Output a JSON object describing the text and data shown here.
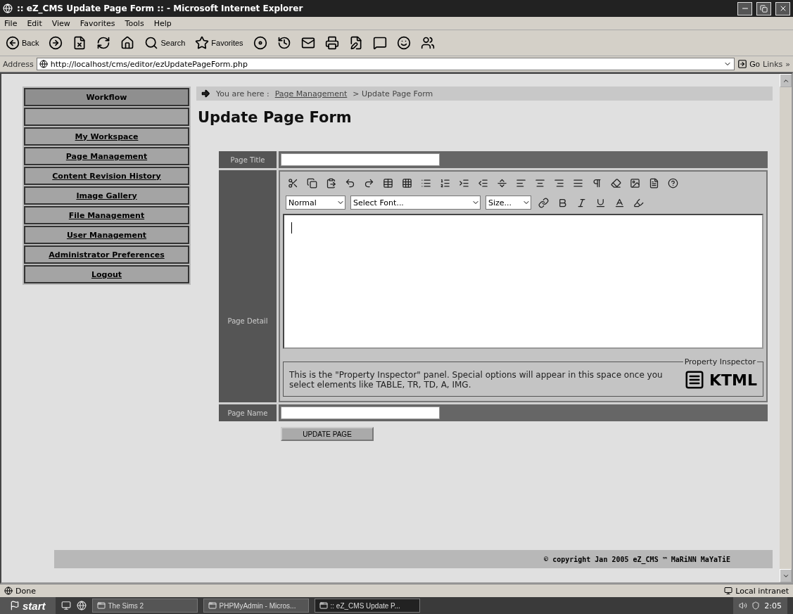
{
  "window": {
    "title": ":: eZ_CMS Update Page Form :: - Microsoft Internet Explorer"
  },
  "menu": [
    "File",
    "Edit",
    "View",
    "Favorites",
    "Tools",
    "Help"
  ],
  "toolbar": [
    {
      "kind": "back",
      "label": "Back"
    },
    {
      "kind": "forward"
    },
    {
      "kind": "stop"
    },
    {
      "kind": "refresh"
    },
    {
      "kind": "home"
    },
    {
      "kind": "search",
      "label": "Search"
    },
    {
      "kind": "favorites",
      "label": "Favorites"
    },
    {
      "kind": "media"
    },
    {
      "kind": "history"
    },
    {
      "kind": "mail"
    },
    {
      "kind": "print"
    },
    {
      "kind": "edit"
    },
    {
      "kind": "discuss"
    },
    {
      "kind": "messenger"
    },
    {
      "kind": "users"
    }
  ],
  "address": {
    "label": "Address",
    "value": "http://localhost/cms/editor/ezUpdatePageForm.php",
    "go": "Go",
    "links": "Links",
    "more": "»"
  },
  "sidebar": {
    "items": [
      {
        "label": "Workflow",
        "kind": "header"
      },
      {
        "kind": "blank"
      },
      {
        "label": "My Workspace",
        "kind": "link"
      },
      {
        "label": "Page Management",
        "kind": "link"
      },
      {
        "label": "Content Revision History",
        "kind": "link"
      },
      {
        "label": "Image Gallery",
        "kind": "link"
      },
      {
        "label": "File Management",
        "kind": "link"
      },
      {
        "label": "User Management",
        "kind": "link"
      },
      {
        "label": "Administrator Preferences",
        "kind": "link"
      },
      {
        "label": "Logout",
        "kind": "link"
      }
    ]
  },
  "breadcrumb": {
    "prefix": "You are here :",
    "link": "Page Management",
    "current": "> Update Page Form"
  },
  "heading": "Update Page Form",
  "form": {
    "title_label": "Page Title",
    "detail_label": "Page Detail",
    "name_label": "Page Name",
    "editor": {
      "toolbar1": [
        {
          "kind": "cut"
        },
        {
          "kind": "copy"
        },
        {
          "kind": "paste"
        },
        {
          "kind": "undo"
        },
        {
          "kind": "redo"
        },
        {
          "kind": "table"
        },
        {
          "kind": "grid"
        },
        {
          "kind": "bullets"
        },
        {
          "kind": "numbers"
        },
        {
          "kind": "indent"
        },
        {
          "kind": "outdent"
        },
        {
          "kind": "rule"
        },
        {
          "kind": "align-left"
        },
        {
          "kind": "align-center"
        },
        {
          "kind": "align-right"
        },
        {
          "kind": "justify"
        },
        {
          "kind": "pilcrow"
        },
        {
          "kind": "clean"
        },
        {
          "kind": "image"
        },
        {
          "kind": "document"
        },
        {
          "kind": "help"
        }
      ],
      "style_select": "Normal",
      "font_select": "Select Font...",
      "size_select": "Size...",
      "toolbar2": [
        {
          "kind": "link"
        },
        {
          "kind": "bold"
        },
        {
          "kind": "italic"
        },
        {
          "kind": "underline"
        },
        {
          "kind": "color"
        },
        {
          "kind": "marker"
        }
      ],
      "inspector": {
        "legend": "Property Inspector",
        "text": "This is the \"Property Inspector\" panel. Special options will appear in this space once you select elements like TABLE, TR, TD, A, IMG.",
        "logo": "KTML"
      }
    },
    "submit": "UPDATE PAGE"
  },
  "footer": "© copyright Jan 2005 eZ_CMS ™ MaRiNN MaYaTiE",
  "status_bar": {
    "text": "Done",
    "zone": "Local intranet"
  },
  "taskbar": {
    "start": "start",
    "tasks": [
      {
        "label": "The Sims 2",
        "selected": false
      },
      {
        "label": "PHPMyAdmin - Micros...",
        "selected": false
      },
      {
        "label": ":: eZ_CMS Update P...",
        "selected": true
      }
    ],
    "clock": "2:05"
  }
}
